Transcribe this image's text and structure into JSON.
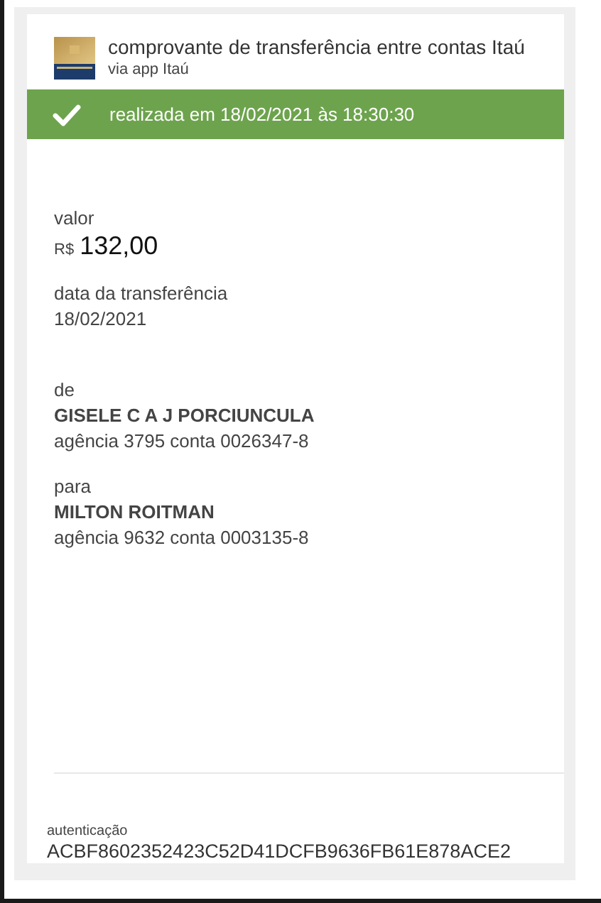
{
  "header": {
    "title": "comprovante de transferência entre contas Itaú",
    "subtitle": "via app Itaú"
  },
  "status": {
    "kind": "success",
    "text": "realizada em 18/02/2021 às 18:30:30"
  },
  "amount": {
    "label": "valor",
    "currency": "R$",
    "value": "132,00"
  },
  "date": {
    "label": "data da transferência",
    "value": "18/02/2021"
  },
  "parties": [
    {
      "label": "de",
      "name": "GISELE C A J PORCIUNCULA",
      "account": "agência 3795 conta 0026347-8"
    },
    {
      "label": "para",
      "name": "MILTON ROITMAN",
      "account": "agência 9632 conta 0003135-8"
    }
  ],
  "authentication": {
    "label": "autenticação",
    "code": "ACBF8602352423C52D41DCFB9636FB61E878ACE2"
  }
}
